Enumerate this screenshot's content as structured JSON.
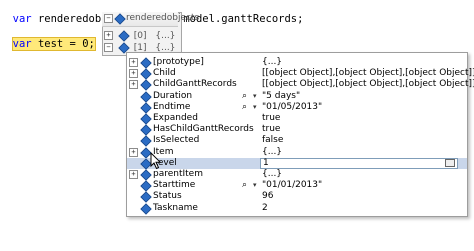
{
  "code": {
    "line1": {
      "keyword": "var",
      "rest": " renderedobjects = this.model.ganttRecords;"
    },
    "line2": {
      "keyword": "var",
      "rest": " test = 0;"
    }
  },
  "outer_tooltip": {
    "title": "renderedobjects",
    "title_value": "{...}",
    "rows": [
      {
        "name": "[0]",
        "value": "{...}"
      },
      {
        "name": "[1]",
        "value": "{...}"
      }
    ]
  },
  "inspector": {
    "rows": [
      {
        "name": "[prototype]",
        "value": "{...}",
        "expandable": true,
        "magnifier": false
      },
      {
        "name": "Child",
        "value": "[[object Object],[object Object],[object Object]]",
        "expandable": true,
        "magnifier": false
      },
      {
        "name": "ChildGanttRecords",
        "value": "[[object Object],[object Object],[object Object]]",
        "expandable": true,
        "magnifier": false
      },
      {
        "name": "Duration",
        "value": "\"5 days\"",
        "expandable": false,
        "magnifier": true
      },
      {
        "name": "Endtime",
        "value": "\"01/05/2013\"",
        "expandable": false,
        "magnifier": true
      },
      {
        "name": "Expanded",
        "value": "true",
        "expandable": false,
        "magnifier": false
      },
      {
        "name": "HasChildGanttRecords",
        "value": "true",
        "expandable": false,
        "magnifier": false
      },
      {
        "name": "IsSelected",
        "value": "false",
        "expandable": false,
        "magnifier": false
      },
      {
        "name": "Item",
        "value": "{...}",
        "expandable": true,
        "magnifier": false
      },
      {
        "name": "Level",
        "value": "1",
        "expandable": false,
        "magnifier": false,
        "selected": true
      },
      {
        "name": "parentItem",
        "value": "{...}",
        "expandable": true,
        "magnifier": false
      },
      {
        "name": "Starttime",
        "value": "\"01/01/2013\"",
        "expandable": false,
        "magnifier": true
      },
      {
        "name": "Status",
        "value": "96",
        "expandable": false,
        "magnifier": false
      },
      {
        "name": "Taskname",
        "value": "2",
        "expandable": false,
        "magnifier": false
      }
    ]
  },
  "icons": {
    "expander": "plus-box-icon",
    "collapse": "minus-box-icon",
    "property": "blue-cube-icon",
    "magnifier": "magnifier-icon",
    "dropdown": "dropdown-arrow-icon",
    "pin": "pin-icon",
    "cursor": "mouse-pointer-icon"
  },
  "colors": {
    "keyword": "#0000ff",
    "highlight": "#ffe97a",
    "selection": "#c9d6ea",
    "property_icon": "#2b6cc4"
  }
}
